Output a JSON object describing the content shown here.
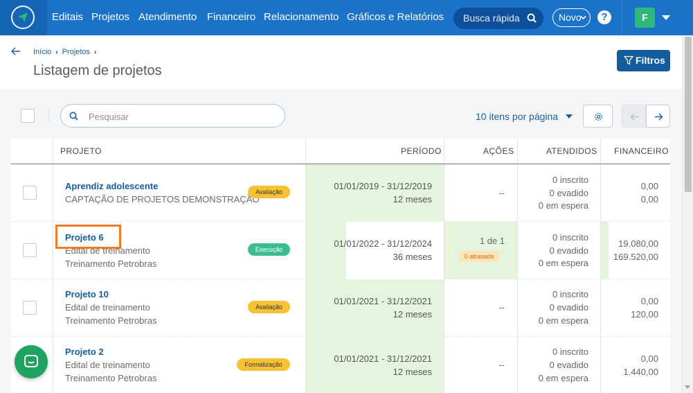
{
  "nav": {
    "items": [
      "Editais",
      "Projetos",
      "Atendimento",
      "Financeiro",
      "Relacionamento",
      "Gráficos e Relatórios"
    ],
    "search_label": "Busca rápida",
    "novo_label": "Novo",
    "help_label": "?",
    "avatar_initial": "F"
  },
  "header": {
    "breadcrumb": [
      "Início",
      "Projetos"
    ],
    "title": "Listagem de projetos",
    "filter_label": "Filtros"
  },
  "toolbar": {
    "search_placeholder": "Pesquisar",
    "per_page_label": "10 itens por página"
  },
  "table": {
    "columns": [
      "PROJETO",
      "PERÍODO",
      "AÇÕES",
      "ATENDIDOS",
      "FINANCEIRO"
    ],
    "rows": [
      {
        "title": "Aprendiz adolescente",
        "subtitle": "CAPTAÇÃO DE PROJETOS DEMONSTRAÇÃO",
        "subtitle2": "",
        "status": "Avaliação",
        "period": "01/01/2019 - 31/12/2019",
        "duration": "12 meses",
        "actions": "--",
        "actions_late": "",
        "atendidos": [
          "0 inscrito",
          "0 evadido",
          "0 em espera"
        ],
        "financeiro": [
          "0,00",
          "0,00"
        ]
      },
      {
        "title": "Projeto 6",
        "subtitle": "Edital de treinamento",
        "subtitle2": "Treinamento Petrobras",
        "status": "Execução",
        "period": "01/01/2022 - 31/12/2024",
        "duration": "36 meses",
        "actions": "1 de 1",
        "actions_late": "0 atrasada",
        "atendidos": [
          "0 inscrito",
          "0 evadido",
          "0 em espera"
        ],
        "financeiro": [
          "19.080,00",
          "169.520,00"
        ]
      },
      {
        "title": "Projeto 10",
        "subtitle": "Edital de treinamento",
        "subtitle2": "Treinamento Petrobras",
        "status": "Avaliação",
        "period": "01/01/2021 - 31/12/2021",
        "duration": "12 meses",
        "actions": "--",
        "actions_late": "",
        "atendidos": [
          "0 inscrito",
          "0 evadido",
          "0 em espera"
        ],
        "financeiro": [
          "0,00",
          "120,00"
        ]
      },
      {
        "title": "Projeto 2",
        "subtitle": "Edital de treinamento",
        "subtitle2": "Treinamento Petrobras",
        "status": "Formalização",
        "period": "01/01/2021 - 31/12/2021",
        "duration": "12 meses",
        "actions": "--",
        "actions_late": "",
        "atendidos": [
          "0 inscrito",
          "0 evadido",
          "0 em espera"
        ],
        "financeiro": [
          "0,00",
          "1.440,00"
        ]
      }
    ]
  },
  "colors": {
    "navbar": "#1a73c8",
    "primary": "#135c9e",
    "period_bg": "#e5f5dd",
    "badge_yellow": "#f5c233",
    "badge_green": "#3dbd8f",
    "highlight": "#f47a21",
    "chat": "#1fa360"
  }
}
